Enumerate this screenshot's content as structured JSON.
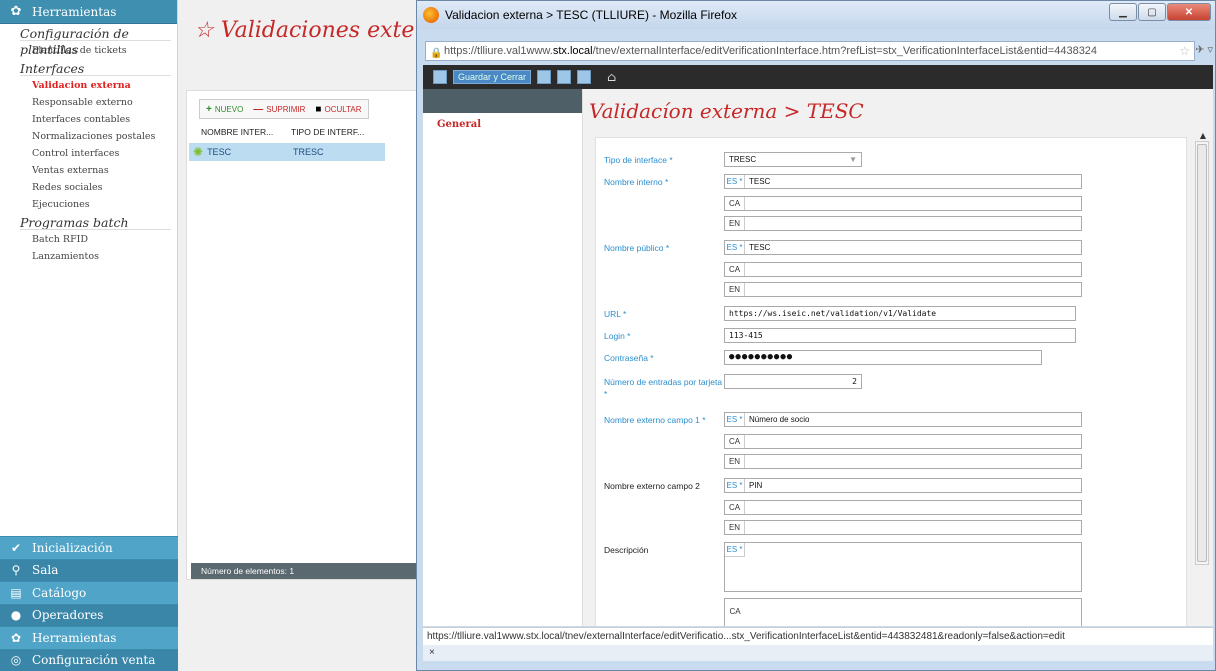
{
  "sidebar": {
    "header": "Herramientas",
    "sections": [
      {
        "title": "Configuración de plantillas",
        "items": [
          "Plantillas de tickets"
        ]
      },
      {
        "title": "Interfaces",
        "items": [
          "Validacion externa",
          "Responsable externo",
          "Interfaces contables",
          "Normalizaciones postales",
          "Control interfaces",
          "Ventas externas",
          "Redes sociales",
          "Ejecuciones"
        ]
      },
      {
        "title": "Programas batch",
        "items": [
          "Batch RFID",
          "Lanzamientos"
        ]
      }
    ],
    "bottom": [
      "Inicialización",
      "Sala",
      "Catálogo",
      "Operadores",
      "Herramientas",
      "Configuración venta"
    ]
  },
  "list": {
    "title": "Validaciones externas",
    "toolbar": {
      "new": "NUEVO",
      "delete": "SUPRIMIR",
      "hide": "OCULTAR"
    },
    "columns": [
      "NOMBRE INTER...",
      "TIPO DE INTERF..."
    ],
    "rows": [
      {
        "name": "TESC",
        "type": "TRESC"
      }
    ],
    "footer": "Número de elementos: 1"
  },
  "firefox": {
    "title": "Validacion externa > TESC (TLLIURE) - Mozilla Firefox",
    "url_pre": "https://tlliure.val1www.",
    "url_host": "stx.local",
    "url_post": "/tnev/externalInterface/editVerificationInterface.htm?refList=stx_VerificationInterfaceList&entid=4438324",
    "toolbar_save_close": "Guardar y Cerrar",
    "status": "https://tlliure.val1www.stx.local/tnev/externalInterface/editVerificatio...stx_VerificationInterfaceList&entid=443832481&readonly=false&action=edit",
    "findbar": "×"
  },
  "form": {
    "tab": "General",
    "title": "Validacíon externa > TESC",
    "labels": {
      "tipo": "Tipo de interface *",
      "nombre_interno": "Nombre interno *",
      "nombre_publico": "Nombre público *",
      "url": "URL *",
      "login": "Login *",
      "password": "Contraseña *",
      "entradas": "Número de entradas por tarjeta *",
      "campo1": "Nombre externo campo 1 *",
      "campo2": "Nombre externo campo 2",
      "descripcion": "Descripción"
    },
    "values": {
      "tipo": "TRESC",
      "nombre_interno_es": "TESC",
      "nombre_publico_es": "TESC",
      "url": "https://ws.iseic.net/validation/v1/Validate",
      "login": "113-415",
      "password": "●●●●●●●●●●",
      "entradas": "2",
      "campo1_es": "Número de socio",
      "campo2_es": "PIN"
    },
    "lang": {
      "es": "ES *",
      "ca": "CA",
      "en": "EN"
    }
  }
}
